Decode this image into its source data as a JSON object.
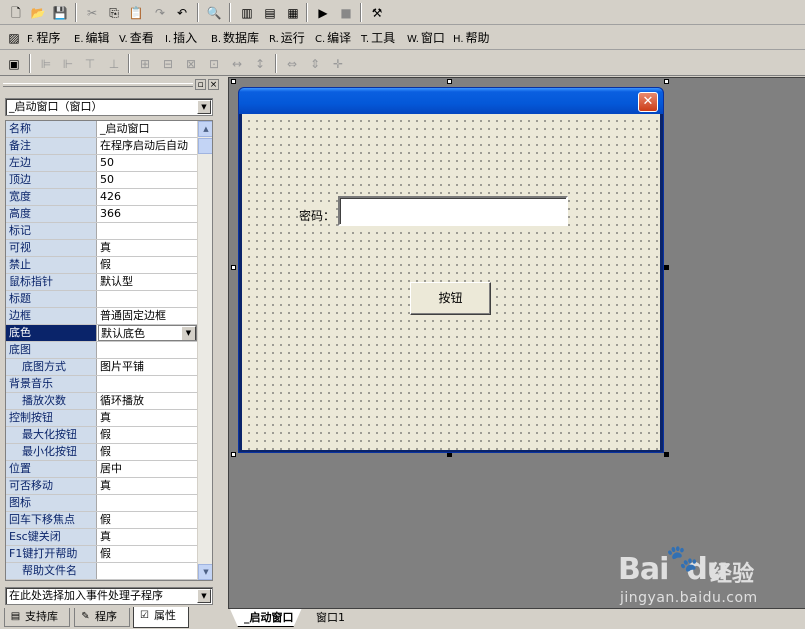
{
  "menu": [
    {
      "key": "F.",
      "label": "程序"
    },
    {
      "key": "E.",
      "label": "编辑"
    },
    {
      "key": "V.",
      "label": "查看"
    },
    {
      "key": "I.",
      "label": "插入"
    },
    {
      "key": "B.",
      "label": "数据库"
    },
    {
      "key": "R.",
      "label": "运行"
    },
    {
      "key": "C.",
      "label": "编译"
    },
    {
      "key": "T.",
      "label": "工具"
    },
    {
      "key": "W.",
      "label": "窗口"
    },
    {
      "key": "H.",
      "label": "帮助"
    }
  ],
  "object_selector": {
    "value": "_启动窗口（窗口）"
  },
  "properties": [
    {
      "name": "名称",
      "value": "_启动窗口",
      "sub": false
    },
    {
      "name": "备注",
      "value": "在程序启动后自动",
      "sub": false
    },
    {
      "name": "左边",
      "value": "50",
      "sub": false
    },
    {
      "name": "顶边",
      "value": "50",
      "sub": false
    },
    {
      "name": "宽度",
      "value": "426",
      "sub": false
    },
    {
      "name": "高度",
      "value": "366",
      "sub": false
    },
    {
      "name": "标记",
      "value": "",
      "sub": false
    },
    {
      "name": "可视",
      "value": "真",
      "sub": false
    },
    {
      "name": "禁止",
      "value": "假",
      "sub": false
    },
    {
      "name": "鼠标指针",
      "value": "默认型",
      "sub": false
    },
    {
      "name": "标题",
      "value": "",
      "sub": false
    },
    {
      "name": "边框",
      "value": "普通固定边框",
      "sub": false
    },
    {
      "name": "底色",
      "value": "默认底色",
      "sub": false,
      "selected": true
    },
    {
      "name": "底图",
      "value": "",
      "sub": false
    },
    {
      "name": "底图方式",
      "value": "图片平铺",
      "sub": true
    },
    {
      "name": "背景音乐",
      "value": "",
      "sub": false
    },
    {
      "name": "播放次数",
      "value": "循环播放",
      "sub": true
    },
    {
      "name": "控制按钮",
      "value": "真",
      "sub": false
    },
    {
      "name": "最大化按钮",
      "value": "假",
      "sub": true
    },
    {
      "name": "最小化按钮",
      "value": "假",
      "sub": true
    },
    {
      "name": "位置",
      "value": "居中",
      "sub": false
    },
    {
      "name": "可否移动",
      "value": "真",
      "sub": false
    },
    {
      "name": "图标",
      "value": "",
      "sub": false
    },
    {
      "name": "回车下移焦点",
      "value": "假",
      "sub": false
    },
    {
      "name": "Esc键关闭",
      "value": "真",
      "sub": false
    },
    {
      "name": "F1键打开帮助",
      "value": "假",
      "sub": false
    },
    {
      "name": "帮助文件名",
      "value": "",
      "sub": true
    }
  ],
  "event_selector": {
    "value": "在此处选择加入事件处理子程序"
  },
  "bottom_tabs": [
    {
      "label": "支持库",
      "icon": "library-icon"
    },
    {
      "label": "程序",
      "icon": "program-icon"
    },
    {
      "label": "属性",
      "icon": "properties-icon",
      "active": true
    }
  ],
  "form": {
    "password_label": "密码：",
    "password_value": "",
    "button_label": "按钮",
    "close_glyph": "✕"
  },
  "doc_tabs": [
    {
      "label": "_启动窗口",
      "active": true
    },
    {
      "label": "窗口1",
      "active": false
    }
  ],
  "watermark": {
    "logo": "Bai",
    "logo_tail": "du",
    "text": "经验",
    "url": "jingyan.baidu.com"
  }
}
